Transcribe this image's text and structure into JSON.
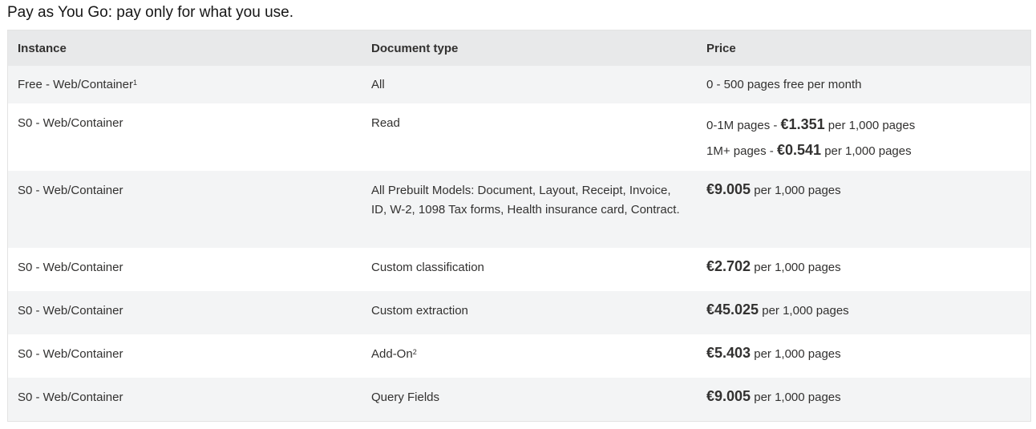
{
  "title": "Pay as You Go: pay only for what you use.",
  "table": {
    "headers": [
      "Instance",
      "Document type",
      "Price"
    ],
    "rows": [
      {
        "instance": "Free - Web/Container",
        "instance_sup": "1",
        "doc_type": "All",
        "doc_sup": "",
        "price_text": "0 - 500 pages free per month"
      },
      {
        "instance": "S0 - Web/Container",
        "instance_sup": "",
        "doc_type": "Read",
        "doc_sup": "",
        "tiers": [
          {
            "prefix": "0-1M pages - ",
            "amount": "€1.351",
            "suffix": " per 1,000 pages"
          },
          {
            "prefix": "1M+ pages - ",
            "amount": "€0.541",
            "suffix": " per 1,000 pages"
          }
        ]
      },
      {
        "instance": "S0 - Web/Container",
        "instance_sup": "",
        "doc_type": "All Prebuilt Models: Document, Layout, Receipt, Invoice, ID, W-2, 1098 Tax forms, Health insurance card, Contract.",
        "doc_sup": "",
        "amount": "€9.005",
        "suffix": " per 1,000 pages"
      },
      {
        "instance": "S0 - Web/Container",
        "instance_sup": "",
        "doc_type": "Custom classification",
        "doc_sup": "",
        "amount": "€2.702",
        "suffix": " per 1,000 pages"
      },
      {
        "instance": "S0 - Web/Container",
        "instance_sup": "",
        "doc_type": "Custom extraction",
        "doc_sup": "",
        "amount": "€45.025",
        "suffix": " per 1,000 pages"
      },
      {
        "instance": "S0 - Web/Container",
        "instance_sup": "",
        "doc_type": "Add-On",
        "doc_sup": "2",
        "amount": "€5.403",
        "suffix": " per 1,000 pages"
      },
      {
        "instance": "S0 - Web/Container",
        "instance_sup": "",
        "doc_type": "Query Fields",
        "doc_sup": "",
        "amount": "€9.005",
        "suffix": " per 1,000 pages"
      }
    ]
  }
}
